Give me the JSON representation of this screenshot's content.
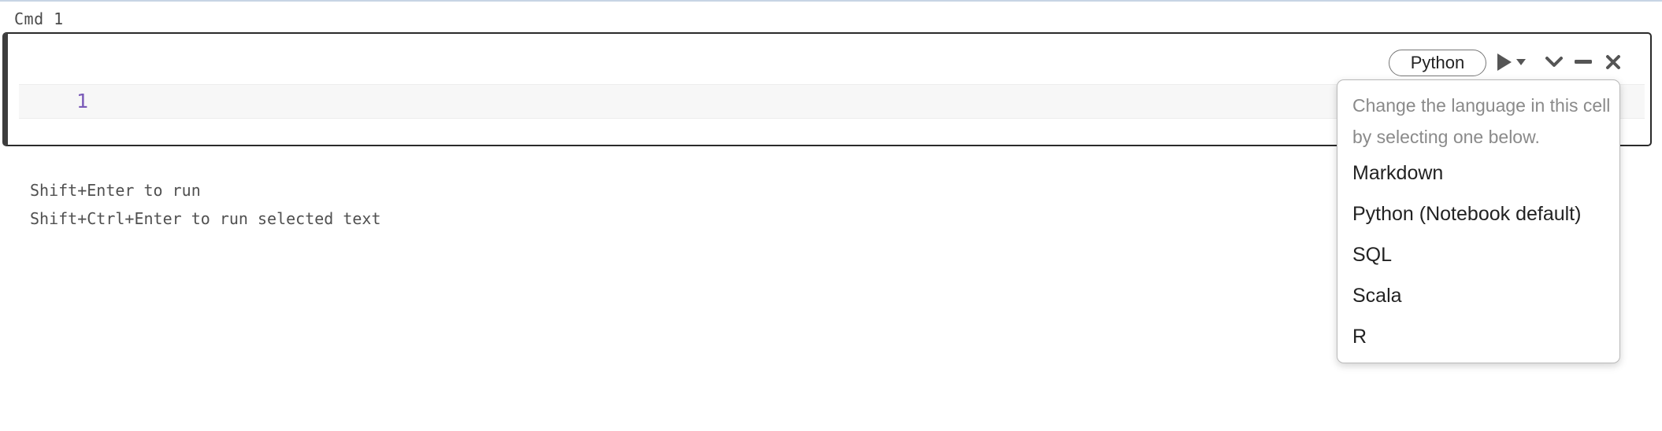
{
  "cell": {
    "command_label": "Cmd 1",
    "line_number": "1",
    "language_button_label": "Python",
    "toolbar_icons": [
      "run-icon",
      "caret-down-icon",
      "chevron-down-icon",
      "minimize-icon",
      "close-icon"
    ]
  },
  "hints": {
    "run": "Shift+Enter to run",
    "run_selected": "Shift+Ctrl+Enter to run selected text"
  },
  "language_menu": {
    "hint": "Change the language in this cell by selecting one below.",
    "items": [
      {
        "label": "Markdown"
      },
      {
        "label": "Python (Notebook default)"
      },
      {
        "label": "SQL"
      },
      {
        "label": "Scala"
      },
      {
        "label": "R"
      }
    ]
  },
  "colors": {
    "line_number": "#7a5ab8",
    "cell_border": "#2a2a2a",
    "menu_border": "#b9b9b9",
    "hint_text": "#8a8a8a"
  }
}
